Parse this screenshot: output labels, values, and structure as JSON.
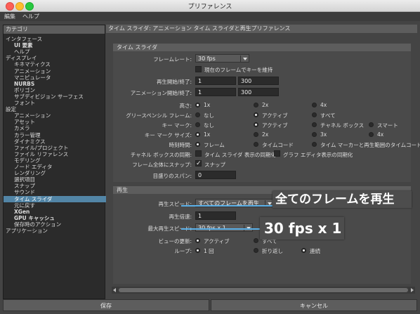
{
  "window": {
    "title": "プリファレンス"
  },
  "menubar": {
    "items": [
      "編集",
      "ヘルプ"
    ]
  },
  "left": {
    "header": "カテゴリ",
    "items": [
      {
        "label": "インタフェース",
        "indent": 0,
        "bold": false
      },
      {
        "label": "UI 要素",
        "indent": 1,
        "bold": true
      },
      {
        "label": "ヘルプ",
        "indent": 1,
        "bold": false
      },
      {
        "label": "ディスプレイ",
        "indent": 0,
        "bold": false
      },
      {
        "label": "キネマティクス",
        "indent": 1,
        "bold": false
      },
      {
        "label": "アニメーション",
        "indent": 1,
        "bold": false
      },
      {
        "label": "マニピュレータ",
        "indent": 1,
        "bold": false
      },
      {
        "label": "NURBS",
        "indent": 1,
        "bold": true
      },
      {
        "label": "ポリゴン",
        "indent": 1,
        "bold": false
      },
      {
        "label": "サブディビジョン サーフェス",
        "indent": 1,
        "bold": false
      },
      {
        "label": "フォント",
        "indent": 1,
        "bold": false
      },
      {
        "label": "設定",
        "indent": 0,
        "bold": false
      },
      {
        "label": "アニメーション",
        "indent": 1,
        "bold": false
      },
      {
        "label": "アセット",
        "indent": 1,
        "bold": false
      },
      {
        "label": "カメラ",
        "indent": 1,
        "bold": false
      },
      {
        "label": "カラー管理",
        "indent": 1,
        "bold": false
      },
      {
        "label": "ダイナミクス",
        "indent": 1,
        "bold": false
      },
      {
        "label": "ファイル/プロジェクト",
        "indent": 1,
        "bold": false
      },
      {
        "label": "ファイル リファレンス",
        "indent": 1,
        "bold": false
      },
      {
        "label": "モデリング",
        "indent": 1,
        "bold": false
      },
      {
        "label": "ノード エディタ",
        "indent": 1,
        "bold": false
      },
      {
        "label": "レンダリング",
        "indent": 1,
        "bold": false
      },
      {
        "label": "選択項目",
        "indent": 1,
        "bold": false
      },
      {
        "label": "スナップ",
        "indent": 1,
        "bold": false
      },
      {
        "label": "サウンド",
        "indent": 1,
        "bold": false
      },
      {
        "label": "タイム スライダ",
        "indent": 1,
        "bold": false,
        "selected": true
      },
      {
        "label": "元に戻す",
        "indent": 1,
        "bold": false
      },
      {
        "label": "XGen",
        "indent": 1,
        "bold": true
      },
      {
        "label": "GPU キャッシュ",
        "indent": 1,
        "bold": true
      },
      {
        "label": "保存時のアクション",
        "indent": 1,
        "bold": false
      },
      {
        "label": "アプリケーション",
        "indent": 0,
        "bold": false
      }
    ]
  },
  "right": {
    "header": "タイム スライダ: アニメーション タイム スライダと再生プリファレンス",
    "time_slider": {
      "section_title": "タイム スライダ",
      "framerate_label": "フレームレート:",
      "framerate_value": "30 fps",
      "keep_key_label": "現在のフレームでキーを維持",
      "playback_range_label": "再生開始/終了:",
      "playback_start": "1",
      "playback_end": "300",
      "anim_range_label": "アニメーション開始/終了:",
      "anim_start": "1",
      "anim_end": "300",
      "height_label": "高さ:",
      "height_options": [
        "1x",
        "2x",
        "4x"
      ],
      "greased_label": "グリースペンシル フレーム:",
      "greased_options": [
        "なし",
        "アクティブ",
        "すべて"
      ],
      "key_marks_label": "キー マーク:",
      "key_marks_options": [
        "なし",
        "アクティブ",
        "チャネル ボックス",
        "スマート"
      ],
      "key_mark_size_label": "キー マーク サイズ:",
      "key_mark_size_options": [
        "1x",
        "2x",
        "3x",
        "4x"
      ],
      "time_display_label": "時刻時間:",
      "time_display_options": [
        "フレーム",
        "タイムコード",
        "タイム マーカーと再生範囲のタイムコード"
      ],
      "channel_sync_label": "チャネル ボックスの同期:",
      "channel_sync_option1": "タイム スライダ 表示の同期化",
      "channel_sync_option2": "グラフ エディタ表示の同期化",
      "snap_label": "フレーム全体にスナップ:",
      "snap_value": "スナップ",
      "tick_span_label": "目盛りのスパン:",
      "tick_span_value": "0"
    },
    "playback": {
      "section_title": "再生",
      "speed_label": "再生スピード:",
      "speed_value": "すべてのフレームを再生",
      "speed_mult_label": "再生倍速:",
      "speed_mult_value": "1",
      "max_speed_label": "最大再生スピード:",
      "max_speed_value": "30 fps x 1",
      "view_update_label": "ビューの更新:",
      "view_update_options": [
        "アクティブ",
        "すべて"
      ],
      "loop_label": "ループ:",
      "loop_options": [
        "1 回",
        "折り返し",
        "連続"
      ]
    },
    "callouts": {
      "playback_all": "全てのフレームを再生",
      "max_speed": "30 fps x 1"
    }
  },
  "buttons": {
    "save": "保存",
    "cancel": "キャンセル"
  },
  "colors": {
    "accent": "#5285a6",
    "callout_line": "#5ab0e8"
  }
}
